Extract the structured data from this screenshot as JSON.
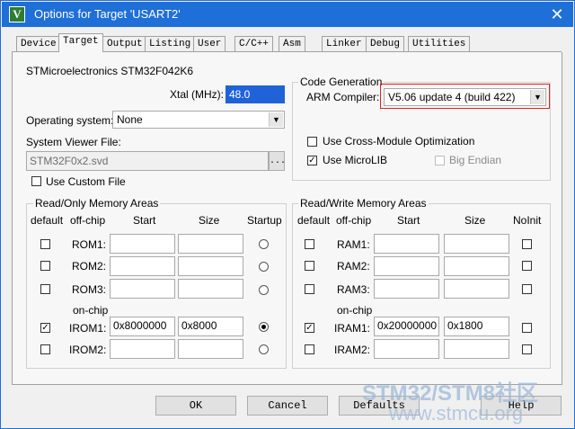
{
  "window": {
    "title": "Options for Target 'USART2'",
    "icon": "keil-uvision-icon",
    "close_glyph": "✕"
  },
  "tabs": [
    {
      "label": "Device",
      "active": false
    },
    {
      "label": "Target",
      "active": true
    },
    {
      "label": "Output",
      "active": false
    },
    {
      "label": "Listing",
      "active": false
    },
    {
      "label": "User",
      "active": false
    },
    {
      "label": "C/C++",
      "active": false
    },
    {
      "label": "Asm",
      "active": false
    },
    {
      "label": "Linker",
      "active": false
    },
    {
      "label": "Debug",
      "active": false
    },
    {
      "label": "Utilities",
      "active": false
    }
  ],
  "device_name": "STMicroelectronics STM32F042K6",
  "xtal": {
    "label": "Xtal (MHz):",
    "value": "48.0"
  },
  "os": {
    "label": "Operating system:",
    "value": "None"
  },
  "svf": {
    "label": "System Viewer File:",
    "value": "STM32F0x2.svd",
    "browse": "...",
    "custom_label": "Use Custom File",
    "custom_checked": false
  },
  "codegen": {
    "title": "Code Generation",
    "compiler_label": "ARM Compiler:",
    "compiler_value": "V5.06 update 4 (build 422)",
    "cross_module_label": "Use Cross-Module Optimization",
    "cross_module_checked": false,
    "microlib_label": "Use MicroLIB",
    "microlib_checked": true,
    "big_endian_label": "Big Endian",
    "big_endian_checked": false
  },
  "rom": {
    "title": "Read/Only Memory Areas",
    "headers": {
      "default": "default",
      "offchip": "off-chip",
      "start": "Start",
      "size": "Size",
      "startup": "Startup"
    },
    "onchip_label": "on-chip",
    "rows": [
      {
        "name": "ROM1:",
        "default": false,
        "start": "",
        "size": "",
        "startup": false
      },
      {
        "name": "ROM2:",
        "default": false,
        "start": "",
        "size": "",
        "startup": false
      },
      {
        "name": "ROM3:",
        "default": false,
        "start": "",
        "size": "",
        "startup": false
      },
      {
        "name": "IROM1:",
        "default": true,
        "start": "0x8000000",
        "size": "0x8000",
        "startup": true
      },
      {
        "name": "IROM2:",
        "default": false,
        "start": "",
        "size": "",
        "startup": false
      }
    ]
  },
  "ram": {
    "title": "Read/Write Memory Areas",
    "headers": {
      "default": "default",
      "offchip": "off-chip",
      "start": "Start",
      "size": "Size",
      "noinit": "NoInit"
    },
    "onchip_label": "on-chip",
    "rows": [
      {
        "name": "RAM1:",
        "default": false,
        "start": "",
        "size": "",
        "noinit": false
      },
      {
        "name": "RAM2:",
        "default": false,
        "start": "",
        "size": "",
        "noinit": false
      },
      {
        "name": "RAM3:",
        "default": false,
        "start": "",
        "size": "",
        "noinit": false
      },
      {
        "name": "IRAM1:",
        "default": true,
        "start": "0x20000000",
        "size": "0x1800",
        "noinit": false
      },
      {
        "name": "IRAM2:",
        "default": false,
        "start": "",
        "size": "",
        "noinit": false
      }
    ]
  },
  "buttons": {
    "ok": "OK",
    "cancel": "Cancel",
    "defaults": "Defaults",
    "help": "Help"
  },
  "watermark": {
    "line1": "STM32/STM8社区",
    "line2": "www.stmcu.org"
  },
  "colors": {
    "titlebar": "#1f6fd8",
    "selection": "#2063d8",
    "highlight_box": "#e02020"
  }
}
